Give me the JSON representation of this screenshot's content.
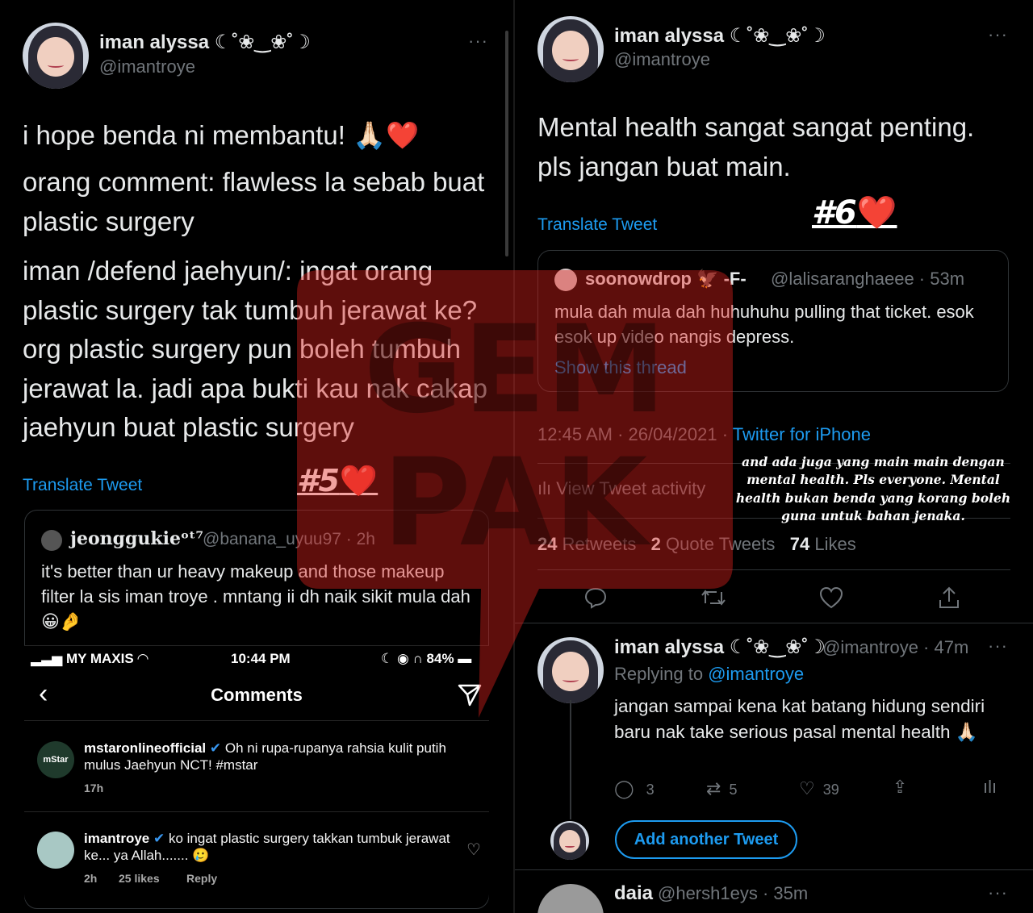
{
  "left_tweet": {
    "name": "iman alyssa ☾˚❀‿❀˚☽",
    "handle": "@imantroye",
    "more": "···",
    "paragraph1": "i hope benda ni membantu! 🙏🏻❤️",
    "paragraph2": "orang comment: flawless la sebab buat plastic surgery",
    "paragraph3": "iman /defend jaehyun/: ingat orang plastic surgery tak tumbuh jerawat ke? org plastic surgery pun boleh tumbuh jerawat la. jadi apa bukti kau nak cakap jaehyun buat plastic surgery",
    "translate": "Translate Tweet",
    "tag": "#5",
    "tag_heart": "❤️",
    "quote": {
      "name": "jeonggukieᵒᵗ⁷",
      "handle": "@banana_uyuu97 · 2h",
      "text": "it's better than ur heavy makeup and those makeup filter la sis iman troye  . mntang ii dh naik sikit mula dah 😀🤌"
    }
  },
  "instagram": {
    "carrier": "MY MAXIS",
    "time": "10:44 PM",
    "battery": "84%",
    "title": "Comments",
    "comment1": {
      "avatar_text": "mStar",
      "user": "mstaronlineofficial",
      "text": "Oh ni rupa-rupanya rahsia kulit putih mulus Jaehyun NCT! #mstar",
      "age": "17h"
    },
    "comment2": {
      "user": "imantroye",
      "text": "ko ingat plastic surgery takkan tumbuk jerawat ke... ya Allah....... 🥲",
      "age": "2h",
      "likes": "25 likes",
      "reply": "Reply"
    }
  },
  "right_tweet": {
    "name": "iman alyssa ☾˚❀‿❀˚☽",
    "handle": "@imantroye",
    "more": "···",
    "text": "Mental health sangat sangat penting. pls jangan buat main.",
    "translate": "Translate Tweet",
    "tag": "#6",
    "tag_heart": "❤️",
    "quote": {
      "name": "soonowdrop 🦅 -F-",
      "handle": "@lalisaranghaeee · 53m",
      "text": "mula dah mula dah huhuhuhu pulling that ticket. esok esok up video nangis depress.",
      "show_thread": "Show this thread"
    },
    "timestamp": "12:45 AM · 26/04/2021 · ",
    "source": "Twitter for iPhone",
    "activity": "View Tweet activity",
    "caption": "and ada juga yang main main dengan mental health. Pls everyone. Mental health bukan benda yang korang boleh guna untuk bahan jenaka.",
    "stats": {
      "retweets_count": "24",
      "retweets_label": "Retweets",
      "quotes_count": "2",
      "quotes_label": "Quote Tweets",
      "likes_count": "74",
      "likes_label": "Likes"
    }
  },
  "reply_tweet": {
    "name": "iman alyssa ☾˚❀‿❀˚☽",
    "handle": "@imantroye · 47m",
    "replying_to_label": "Replying to ",
    "replying_to_handle": "@imantroye",
    "text": "jangan sampai kena kat batang hidung sendiri baru nak take serious pasal mental health 🙏🏻",
    "replies": "3",
    "retweets": "5",
    "likes": "39",
    "add_another": "Add another Tweet"
  },
  "next_tweet": {
    "name": "daia",
    "handle": "@hersh1eys · 35m"
  },
  "watermark": {
    "line1": "GEM",
    "line2": "PAK",
    "color": "#e0221c"
  }
}
